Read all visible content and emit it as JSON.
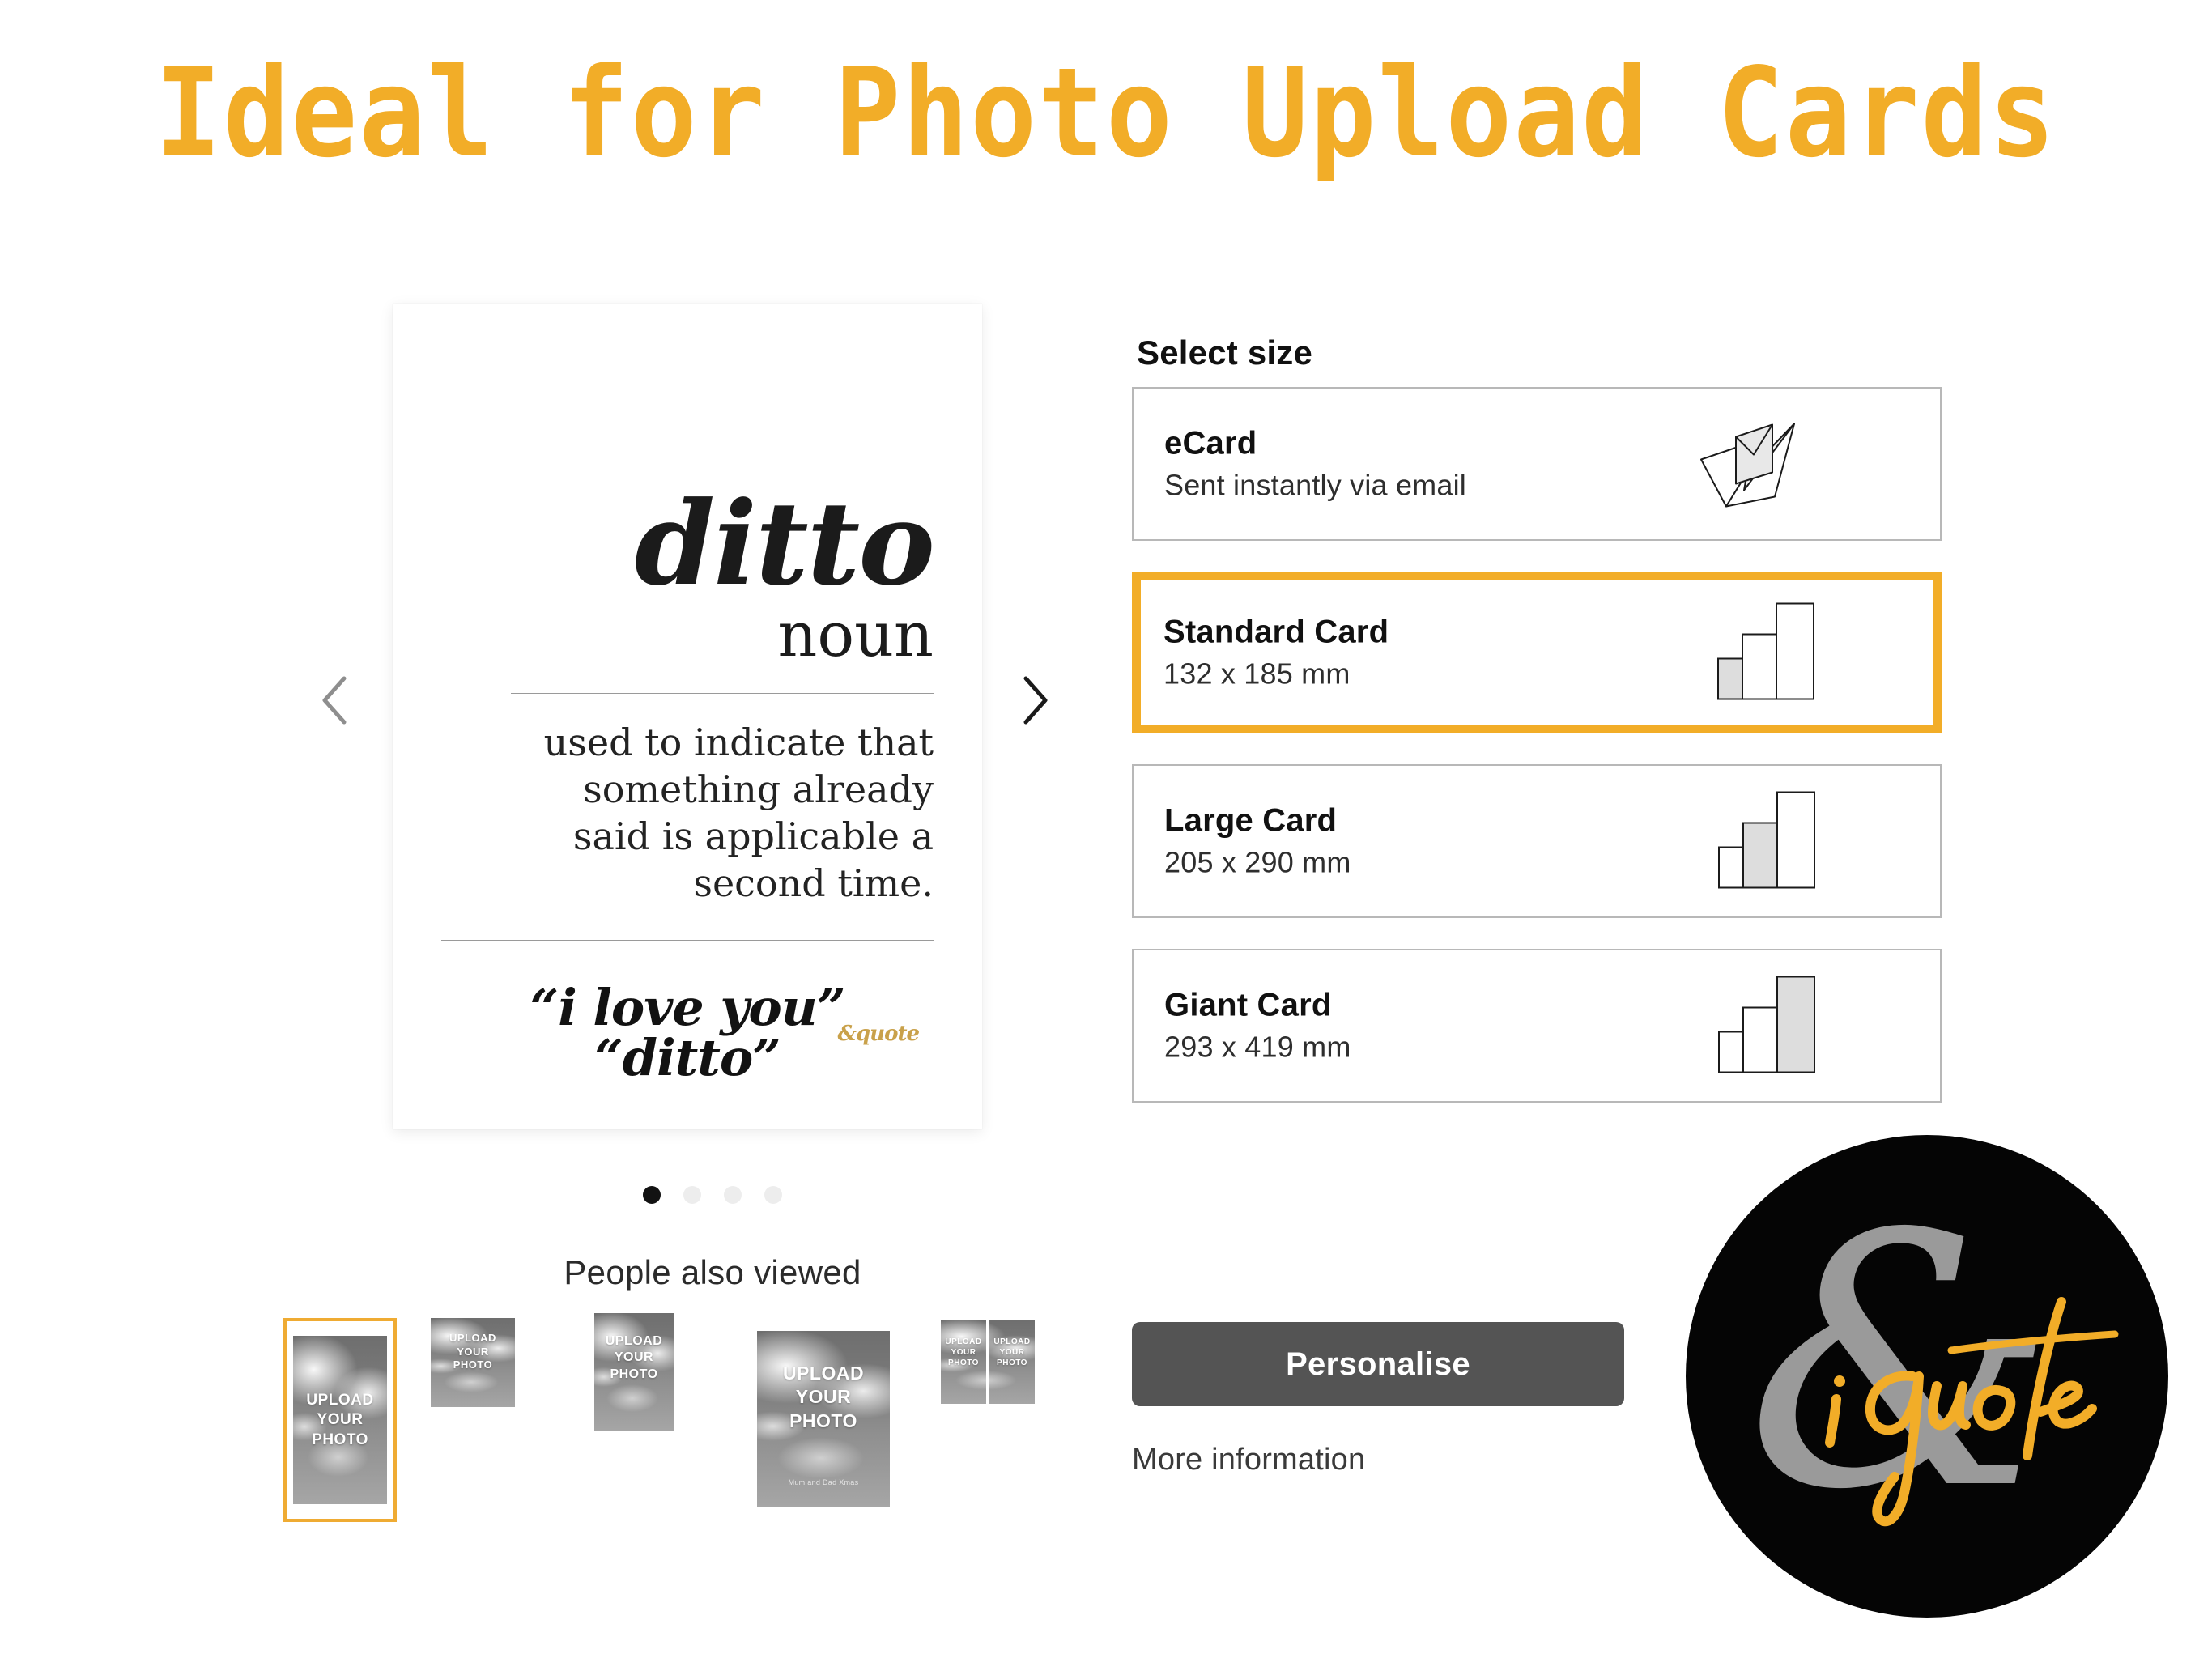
{
  "page": {
    "title": "Ideal for Photo Upload Cards",
    "accent_color": "#F2AD28",
    "background_color": "#FFFFFF"
  },
  "card_preview": {
    "word": "ditto",
    "part_of_speech": "noun",
    "definition": "used to indicate that something already said is applicable a second time.",
    "quote": "“i love you” “ditto”",
    "brandmark": "&quote",
    "prev_arrow_icon": "chevron-left-icon",
    "next_arrow_icon": "chevron-right-icon",
    "dots": [
      {
        "active": true
      },
      {
        "active": false
      },
      {
        "active": false
      },
      {
        "active": false
      }
    ]
  },
  "people_also_viewed": {
    "heading": "People also viewed",
    "thumbnails": [
      {
        "line1": "UPLOAD",
        "line2": "YOUR",
        "line3": "PHOTO",
        "selected": true,
        "kind": "portrait-tall"
      },
      {
        "line1": "UPLOAD",
        "line2": "YOUR",
        "line3": "PHOTO",
        "selected": false,
        "kind": "landscape-small"
      },
      {
        "line1": "UPLOAD",
        "line2": "YOUR",
        "line3": "PHOTO",
        "selected": false,
        "kind": "portrait-medium"
      },
      {
        "line1": "UPLOAD",
        "line2": "YOUR",
        "line3": "PHOTO",
        "subtext": "Mum and Dad Xmas",
        "selected": false,
        "kind": "portrait-large"
      },
      {
        "line1": "UPLOAD",
        "line2": "YOUR",
        "line3": "PHOTO",
        "selected": false,
        "kind": "split-double"
      }
    ]
  },
  "select_size": {
    "label": "Select size",
    "options": [
      {
        "name": "eCard",
        "sub": "Sent instantly via email",
        "icon": "paper-plane-envelope-icon",
        "selected": false,
        "highlight_index": -1
      },
      {
        "name": "Standard Card",
        "sub": "132 x 185 mm",
        "icon": "card-size-bars-icon",
        "selected": true,
        "highlight_index": 0
      },
      {
        "name": "Large Card",
        "sub": "205 x 290 mm",
        "icon": "card-size-bars-icon",
        "selected": false,
        "highlight_index": 1
      },
      {
        "name": "Giant Card",
        "sub": "293 x 419 mm",
        "icon": "card-size-bars-icon",
        "selected": false,
        "highlight_index": 2
      }
    ]
  },
  "actions": {
    "personalise_label": "Personalise",
    "more_information_label": "More information"
  },
  "brand_badge": {
    "ampersand": "&",
    "script_text": "i quote",
    "circle_color": "#050505",
    "ampersand_color": "#9A9A9A",
    "script_color": "#F2AD28"
  }
}
